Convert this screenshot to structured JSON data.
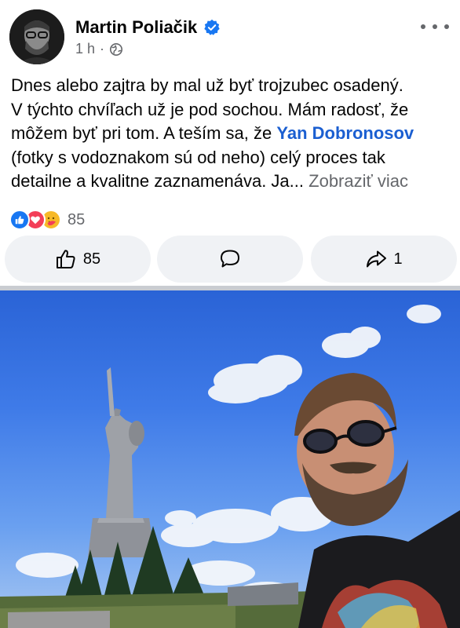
{
  "post": {
    "author": "Martin Poliačik",
    "time": "1 h",
    "separator": "·",
    "text_line1": "Dnes alebo zajtra by mal už byť trojzubec osadený.",
    "text_line2": "V týchto chvíľach už je pod sochou. Mám radosť, že",
    "text_line3": "môžem byť pri tom. A teším sa, že",
    "mention": "Yan Dobronosov",
    "text_line4": "(fotky s vodoznakom sú od neho) celý proces tak",
    "text_line5": "detailne a kvalitne zaznamenáva. Ja...",
    "see_more": "Zobraziť viac"
  },
  "reactions": {
    "icons": [
      "like-reaction",
      "love-reaction",
      "care-reaction"
    ],
    "count": "85"
  },
  "actions": {
    "like_count": "85",
    "share_count": "1"
  },
  "colors": {
    "link": "#1b5fd1",
    "muted": "#65676b",
    "button_bg": "#f0f2f5",
    "like_blue": "#1877f2",
    "love_red": "#f33e58",
    "care_yellow": "#f7b928"
  }
}
